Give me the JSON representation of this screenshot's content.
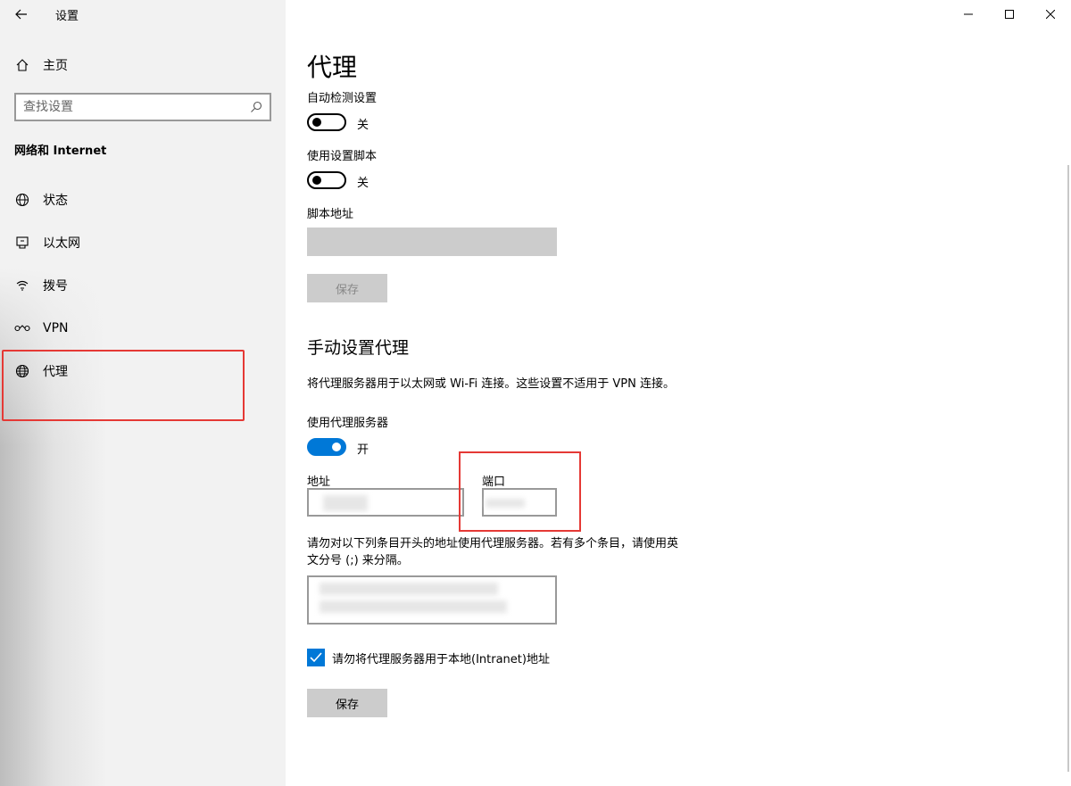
{
  "window": {
    "title": "设置",
    "back_icon": "back-arrow-icon",
    "controls": [
      "minimize",
      "maximize",
      "close"
    ]
  },
  "sidebar": {
    "home_label": "主页",
    "search_placeholder": "查找设置",
    "section_title": "网络和 Internet",
    "items": [
      {
        "label": "状态",
        "icon": "status-globe-icon"
      },
      {
        "label": "以太网",
        "icon": "ethernet-icon"
      },
      {
        "label": "拨号",
        "icon": "dialup-icon"
      },
      {
        "label": "VPN",
        "icon": "vpn-icon"
      },
      {
        "label": "代理",
        "icon": "globe-icon",
        "selected": true
      }
    ]
  },
  "main": {
    "title": "代理",
    "auto_detect": {
      "label": "自动检测设置",
      "state": "关",
      "on": false
    },
    "use_script": {
      "label": "使用设置脚本",
      "state": "关",
      "on": false
    },
    "script_address": {
      "label": "脚本地址",
      "value": ""
    },
    "save_script_button": "保存",
    "manual_heading": "手动设置代理",
    "manual_desc": "将代理服务器用于以太网或 Wi-Fi 连接。这些设置不适用于 VPN 连接。",
    "use_proxy": {
      "label": "使用代理服务器",
      "state": "开",
      "on": true
    },
    "address": {
      "label": "地址",
      "value": ""
    },
    "port": {
      "label": "端口",
      "value": ""
    },
    "exceptions_desc_line1": "请勿对以下列条目开头的地址使用代理服务器。若有多个条目，请使用英",
    "exceptions_desc_line2": "文分号 (;) 来分隔。",
    "exceptions_value": "",
    "bypass_local": {
      "label": "请勿将代理服务器用于本地(Intranet)地址",
      "checked": true
    },
    "save_button": "保存"
  },
  "colors": {
    "accent": "#0078d7",
    "highlight": "#e53935",
    "sidebar_bg": "#f2f2f2",
    "disabled": "#cccccc"
  }
}
